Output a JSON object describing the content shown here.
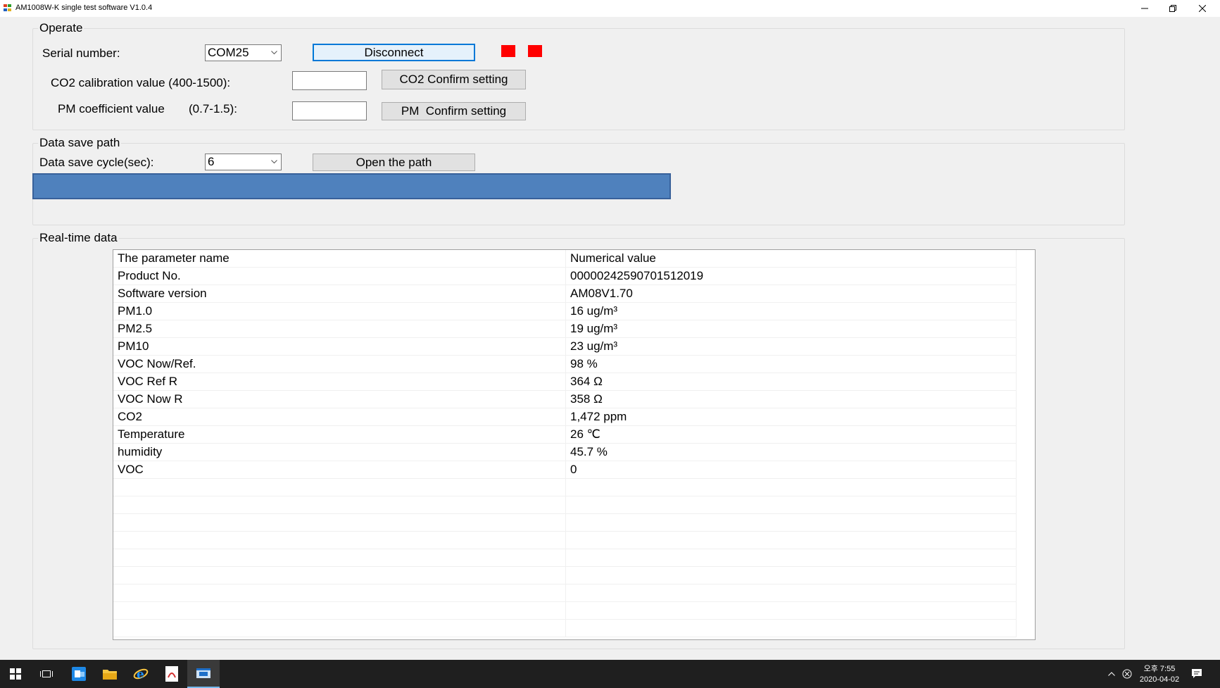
{
  "window": {
    "title": "AM1008W-K single test software V1.0.4"
  },
  "operate": {
    "group_title": "Operate",
    "serial_label": "Serial number:",
    "serial_value": "COM25",
    "disconnect_label": "Disconnect",
    "co2_label": "CO2 calibration value (400-1500):",
    "co2_value": "",
    "co2_button": "CO2 Confirm setting",
    "pm_label": "PM coefficient value",
    "pm_range": "(0.7-1.5):",
    "pm_value": "",
    "pm_button": "PM  Confirm setting",
    "indicator_color": "#ff0000"
  },
  "save_path": {
    "group_title": "Data save path",
    "cycle_label": "Data save cycle(sec):",
    "cycle_value": "6",
    "open_button": "Open the path",
    "path_value": ""
  },
  "realtime": {
    "group_title": "Real-time data",
    "rows": [
      {
        "name": "The parameter name",
        "value": "Numerical value"
      },
      {
        "name": "Product No.",
        "value": "00000242590701512019"
      },
      {
        "name": "Software version",
        "value": "AM08V1.70"
      },
      {
        "name": "PM1.0",
        "value": "16 ug/m³"
      },
      {
        "name": "PM2.5",
        "value": "19 ug/m³"
      },
      {
        "name": "PM10",
        "value": "23 ug/m³"
      },
      {
        "name": "VOC Now/Ref.",
        "value": "98 %"
      },
      {
        "name": "VOC Ref R",
        "value": "364 Ω"
      },
      {
        "name": "VOC Now R",
        "value": "358 Ω"
      },
      {
        "name": "CO2",
        "value": "1,472 ppm"
      },
      {
        "name": "Temperature",
        "value": "26 ℃"
      },
      {
        "name": "humidity",
        "value": "45.7 %"
      },
      {
        "name": "VOC",
        "value": "0"
      },
      {
        "name": "",
        "value": ""
      },
      {
        "name": "",
        "value": ""
      },
      {
        "name": "",
        "value": ""
      },
      {
        "name": "",
        "value": ""
      },
      {
        "name": "",
        "value": ""
      },
      {
        "name": "",
        "value": ""
      },
      {
        "name": "",
        "value": ""
      },
      {
        "name": "",
        "value": ""
      },
      {
        "name": "",
        "value": ""
      }
    ]
  },
  "taskbar": {
    "time": "오후 7:55",
    "date": "2020-04-02",
    "icons": [
      "windows-start-icon",
      "task-view-icon",
      "outlook-icon",
      "file-explorer-icon",
      "internet-explorer-icon",
      "pdf-icon",
      "app-window-icon"
    ]
  }
}
